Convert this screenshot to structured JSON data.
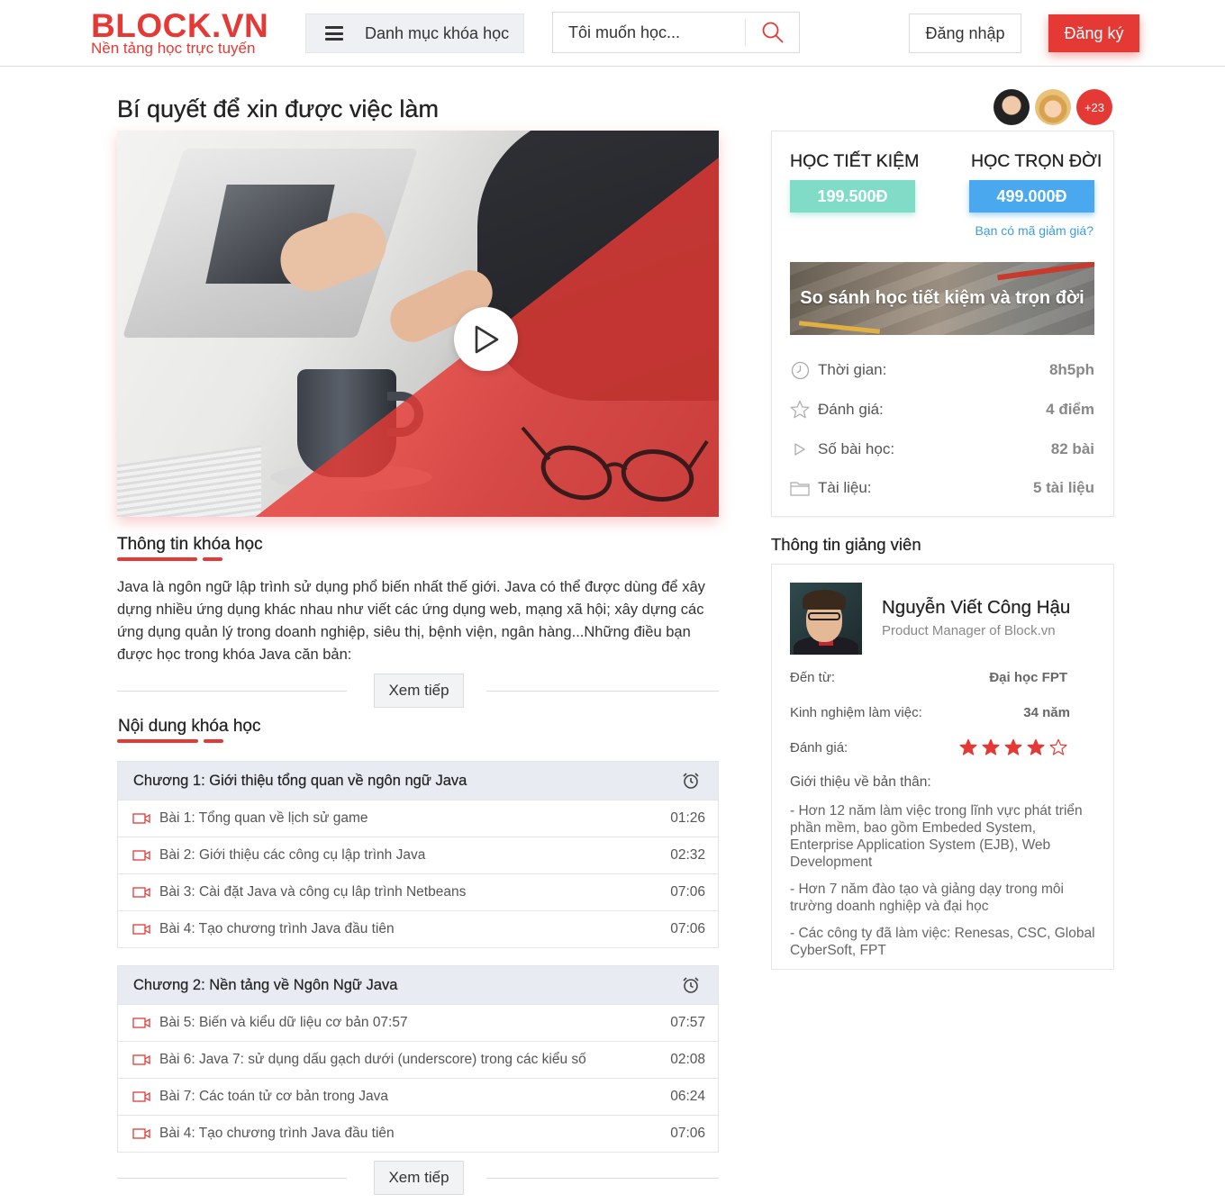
{
  "header": {
    "logo_main": "BLOCK.VN",
    "logo_sub": "Nền tảng học trực tuyến",
    "category_label": "Danh mục khóa học",
    "search_placeholder": "Tôi muốn học...",
    "login_label": "Đăng nhập",
    "signup_label": "Đăng ký"
  },
  "course": {
    "title": "Bí quyết để xin được việc làm",
    "extra_learners": "+23"
  },
  "info": {
    "heading": "Thông tin khóa học",
    "description": "Java là ngôn ngữ lập trình sử dụng phổ biến nhất thế giới. Java có thể được dùng để xây dựng nhiều ứng dụng khác nhau như viết các ứng dụng web, mạng xã hội; xây dựng các ứng dụng quản lý trong doanh nghiệp, siêu thị, bệnh viện, ngân hàng...Những điều bạn được học trong khóa Java căn bản:",
    "more_label": "Xem tiếp"
  },
  "content": {
    "heading": "Nội dung khóa học",
    "more_label": "Xem tiếp",
    "chapters": [
      {
        "title": "Chương 1: Giới thiệu tổng quan về ngôn ngữ Java",
        "lessons": [
          {
            "title": "Bài 1: Tổng quan về lịch sử game",
            "duration": "01:26"
          },
          {
            "title": "Bài 2:  Giới thiệu các công cụ lập trình Java",
            "duration": "02:32"
          },
          {
            "title": "Bài 3: Cài đặt Java và công cụ lâp trình Netbeans",
            "duration": "07:06"
          },
          {
            "title": "Bài 4: Tạo chương trình Java đầu tiên",
            "duration": "07:06"
          }
        ]
      },
      {
        "title": "Chương 2: Nền tảng về Ngôn Ngữ Java",
        "lessons": [
          {
            "title": "Bài 5: Biến và kiểu dữ liệu cơ bản 07:57",
            "duration": "07:57"
          },
          {
            "title": "Bài 6: Java 7: sử dụng dấu gạch dưới (underscore) trong các kiểu số",
            "duration": "02:08"
          },
          {
            "title": "Bài 7: Các toán tử cơ bản trong Java",
            "duration": "06:24"
          },
          {
            "title": "Bài 4: Tạo chương trình Java đầu tiên",
            "duration": "07:06"
          }
        ]
      }
    ]
  },
  "pricing": {
    "saving_label": "HỌC TIẾT KIỆM",
    "saving_price": "199.500Đ",
    "lifetime_label": "HỌC TRỌN ĐỜI",
    "lifetime_price": "499.000Đ",
    "coupon_label": "Bạn có mã giảm giá?",
    "compare_label": "So sánh học tiết kiệm và trọn đời",
    "stats": [
      {
        "icon": "clock-icon",
        "key": "Thời gian:",
        "value": "8h5ph"
      },
      {
        "icon": "star-outline-icon",
        "key": "Đánh giá:",
        "value": "4 điểm"
      },
      {
        "icon": "play-outline-icon",
        "key": "Số bài học:",
        "value": "82 bài"
      },
      {
        "icon": "folder-icon",
        "key": "Tài liệu:",
        "value": "5 tài liệu"
      }
    ]
  },
  "instructor": {
    "heading": "Thông tin giảng viên",
    "name": "Nguyễn Viết Công Hậu",
    "role": "Product Manager of Block.vn",
    "from_key": "Đến từ:",
    "from_value": "Đại học FPT",
    "exp_key": "Kinh nghiệm làm việc:",
    "exp_value": "34 năm",
    "rating_key": "Đánh giá:",
    "rating_value": 4,
    "rating_max": 5,
    "bio_heading": "Giới thiệu về bản thân:",
    "bio": [
      "- Hơn 12 năm làm việc trong lĩnh vực phát triển phần mềm, bao gồm Embeded System, Enterprise Application System (EJB), Web Development",
      "- Hơn 7 năm đào tạo và giảng dạy trong môi trường doanh nghiệp và đại học",
      "- Các công ty đã làm việc: Renesas, CSC, Global CyberSoft, FPT"
    ]
  },
  "colors": {
    "brand_red": "#e53935",
    "teal": "#80dcc7",
    "blue": "#4aa9ee",
    "chapter_bg": "#e8ebf1"
  }
}
